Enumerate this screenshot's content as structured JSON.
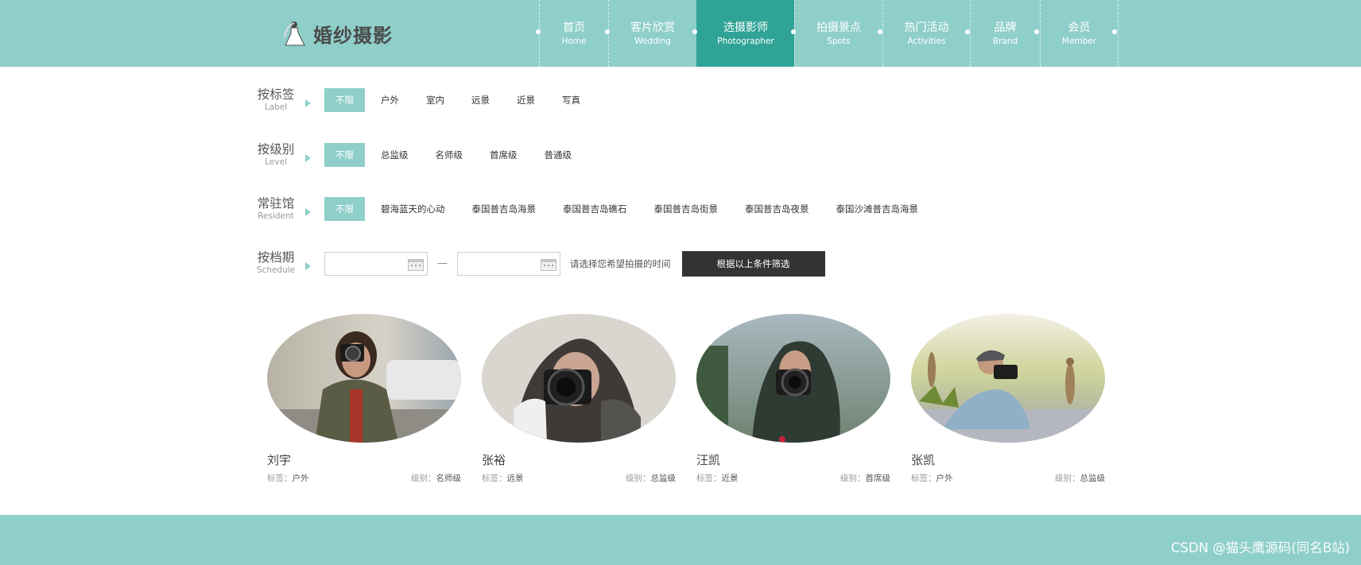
{
  "logo": {
    "text": "婚纱摄影"
  },
  "nav": [
    {
      "cn": "首页",
      "en": "Home"
    },
    {
      "cn": "客片欣赏",
      "en": "Wedding"
    },
    {
      "cn": "选摄影师",
      "en": "Photographer",
      "active": true
    },
    {
      "cn": "拍摄景点",
      "en": "Spots"
    },
    {
      "cn": "热门活动",
      "en": "Activities"
    },
    {
      "cn": "品牌",
      "en": "Brand"
    },
    {
      "cn": "会员",
      "en": "Member"
    }
  ],
  "filters": {
    "label": {
      "cn": "按标签",
      "en": "Label",
      "options": [
        "不限",
        "户外",
        "室内",
        "远景",
        "近景",
        "写真"
      ]
    },
    "level": {
      "cn": "按级别",
      "en": "Level",
      "options": [
        "不限",
        "总监级",
        "名师级",
        "首席级",
        "普通级"
      ]
    },
    "resident": {
      "cn": "常驻馆",
      "en": "Resident",
      "options": [
        "不限",
        "碧海蓝天的心动",
        "泰国普吉岛海景",
        "泰国普吉岛礁石",
        "泰国普吉岛街景",
        "泰国普吉岛夜景",
        "泰国沙滩普吉岛海景"
      ]
    },
    "schedule": {
      "cn": "按档期",
      "en": "Schedule",
      "separator": "—",
      "hint": "请选择您希望拍摄的时间",
      "button": "根据以上条件筛选"
    }
  },
  "photographers": [
    {
      "name": "刘宇",
      "tag_key": "标签：",
      "tag": "户外",
      "level_key": "级别：",
      "level": "名师级"
    },
    {
      "name": "张裕",
      "tag_key": "标签：",
      "tag": "远景",
      "level_key": "级别：",
      "level": "总监级"
    },
    {
      "name": "汪凯",
      "tag_key": "标签：",
      "tag": "近景",
      "level_key": "级别：",
      "level": "首席级"
    },
    {
      "name": "张凯",
      "tag_key": "标签：",
      "tag": "户外",
      "level_key": "级别：",
      "level": "总监级"
    }
  ],
  "watermark": "CSDN @猫头鹰源码(同名B站)",
  "colors": {
    "theme": "#8fcfca",
    "active": "#2fa396",
    "button": "#333333"
  }
}
